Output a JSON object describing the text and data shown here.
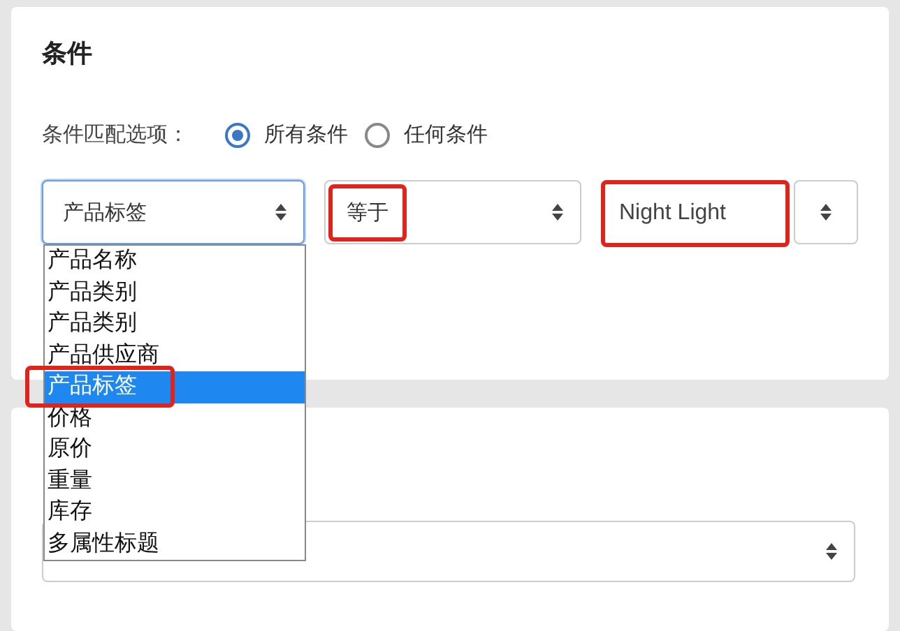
{
  "conditions_card": {
    "title": "条件",
    "match_label": "条件匹配选项：",
    "match_options": [
      {
        "label": "所有条件",
        "selected": true
      },
      {
        "label": "任何条件",
        "selected": false
      }
    ],
    "field_select": {
      "value": "产品标签",
      "expanded": true,
      "options": [
        {
          "label": "产品名称",
          "selected": false,
          "highlighted": false
        },
        {
          "label": "产品类别",
          "selected": false,
          "highlighted": false
        },
        {
          "label": "产品类别",
          "selected": false,
          "highlighted": false
        },
        {
          "label": "产品供应商",
          "selected": false,
          "highlighted": false
        },
        {
          "label": "产品标签",
          "selected": true,
          "highlighted": true
        },
        {
          "label": "价格",
          "selected": false,
          "highlighted": false
        },
        {
          "label": "原价",
          "selected": false,
          "highlighted": false
        },
        {
          "label": "重量",
          "selected": false,
          "highlighted": false
        },
        {
          "label": "库存",
          "selected": false,
          "highlighted": false
        },
        {
          "label": "多属性标题",
          "selected": false,
          "highlighted": false
        }
      ]
    },
    "operator_select": {
      "value": "等于",
      "highlighted": true
    },
    "value_field": {
      "value": "Night Light",
      "highlighted": true
    }
  }
}
